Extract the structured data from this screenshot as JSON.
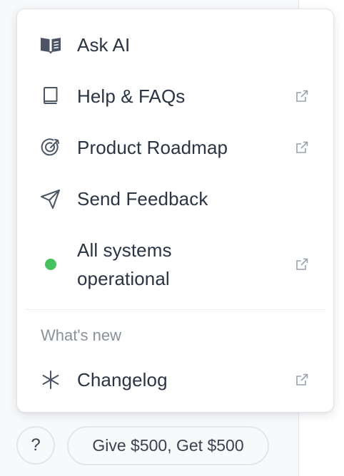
{
  "menu": {
    "items": [
      {
        "label": "Ask AI",
        "icon": "book-open-icon",
        "external": false
      },
      {
        "label": "Help & FAQs",
        "icon": "book-icon",
        "external": true
      },
      {
        "label": "Product Roadmap",
        "icon": "target-icon",
        "external": true
      },
      {
        "label": "Send Feedback",
        "icon": "send-icon",
        "external": false
      },
      {
        "label": "All systems operational",
        "icon": "status-dot",
        "external": true
      }
    ],
    "section_title": "What's new",
    "section_items": [
      {
        "label": "Changelog",
        "icon": "asterisk-icon",
        "external": true
      }
    ]
  },
  "footer": {
    "help_label": "?",
    "referral_label": "Give $500, Get $500"
  },
  "colors": {
    "text": "#2b3442",
    "muted": "#8a919b",
    "icon": "#4b5563",
    "status_ok": "#47c160",
    "border": "#e2e5e9"
  }
}
